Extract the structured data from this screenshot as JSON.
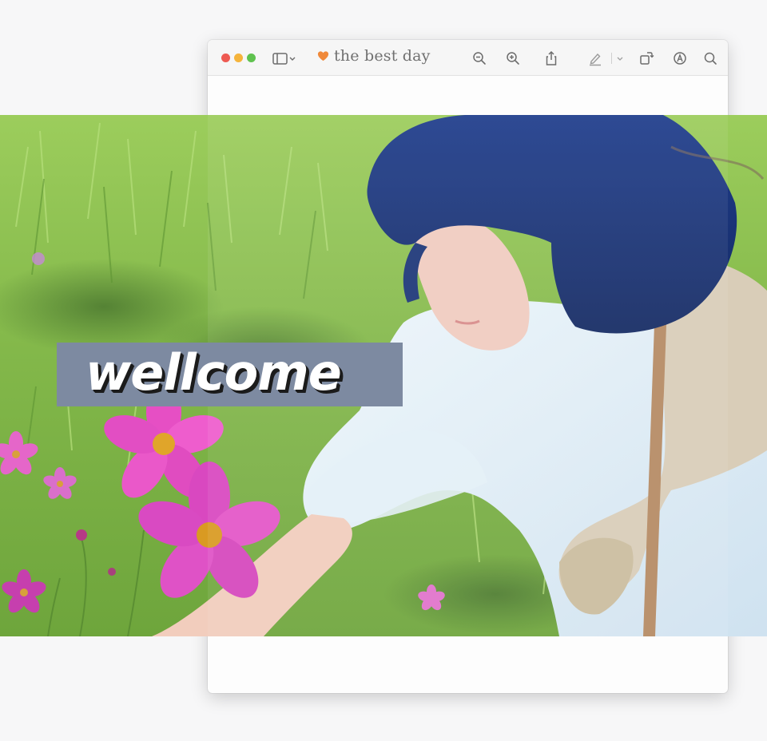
{
  "window": {
    "title": "the best day",
    "title_icon": "heart-icon",
    "buttons": {
      "close": "close-button",
      "minimize": "minimize-button",
      "zoom": "zoom-button"
    },
    "toolbar_icons": [
      "sidebar-toggle-icon",
      "zoom-out-icon",
      "zoom-in-icon",
      "share-icon",
      "highlight-icon",
      "rotate-icon",
      "markup-icon",
      "search-icon"
    ]
  },
  "banner": {
    "text": "wellcome",
    "background_color": "#7d8aa1"
  },
  "colors": {
    "close": "#ee5a52",
    "minimize": "#f5b43c",
    "zoom": "#5fc24f",
    "heart": "#f0893a"
  }
}
